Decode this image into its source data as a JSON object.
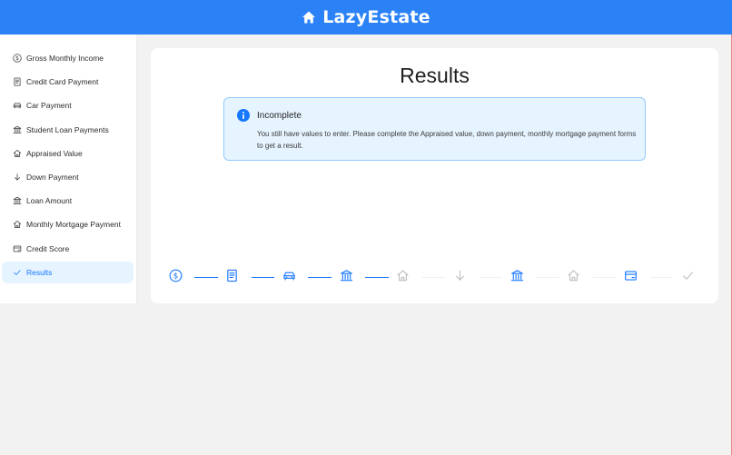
{
  "app": {
    "title": "LazyEstate",
    "icon": "home-icon"
  },
  "sidebar": {
    "items": [
      {
        "label": "Gross Monthly Income",
        "icon": "dollar-circle-icon"
      },
      {
        "label": "Credit Card Payment",
        "icon": "receipt-icon"
      },
      {
        "label": "Car Payment",
        "icon": "car-icon"
      },
      {
        "label": "Student Loan Payments",
        "icon": "bank-icon"
      },
      {
        "label": "Appraised Value",
        "icon": "home-outline-icon"
      },
      {
        "label": "Down Payment",
        "icon": "arrow-down-icon"
      },
      {
        "label": "Loan Amount",
        "icon": "bank-icon"
      },
      {
        "label": "Monthly Mortgage Payment",
        "icon": "home-outline-icon"
      },
      {
        "label": "Credit Score",
        "icon": "credit-card-icon"
      },
      {
        "label": "Results",
        "icon": "check-icon",
        "active": true
      }
    ]
  },
  "main": {
    "title": "Results",
    "alert": {
      "title": "Incomplete",
      "description": "You still have values to enter. Please complete the Appraised value, down payment, monthly mortgage payment forms to get a result.",
      "icon": "info-circle-icon"
    },
    "steps": [
      {
        "icon": "dollar-circle-icon",
        "status": "finished"
      },
      {
        "icon": "receipt-icon",
        "status": "finished"
      },
      {
        "icon": "car-icon",
        "status": "finished"
      },
      {
        "icon": "bank-icon",
        "status": "finished"
      },
      {
        "icon": "home-outline-icon",
        "status": "wait"
      },
      {
        "icon": "arrow-down-icon",
        "status": "wait"
      },
      {
        "icon": "bank-icon",
        "status": "finished"
      },
      {
        "icon": "home-outline-icon",
        "status": "wait"
      },
      {
        "icon": "credit-card-icon",
        "status": "finished"
      },
      {
        "icon": "check-icon",
        "status": "wait"
      }
    ]
  },
  "colors": {
    "primary": "#2a82f6",
    "accent": "#1677ff",
    "pending": "#bfbfbf",
    "active_bg": "#e6f4ff"
  }
}
